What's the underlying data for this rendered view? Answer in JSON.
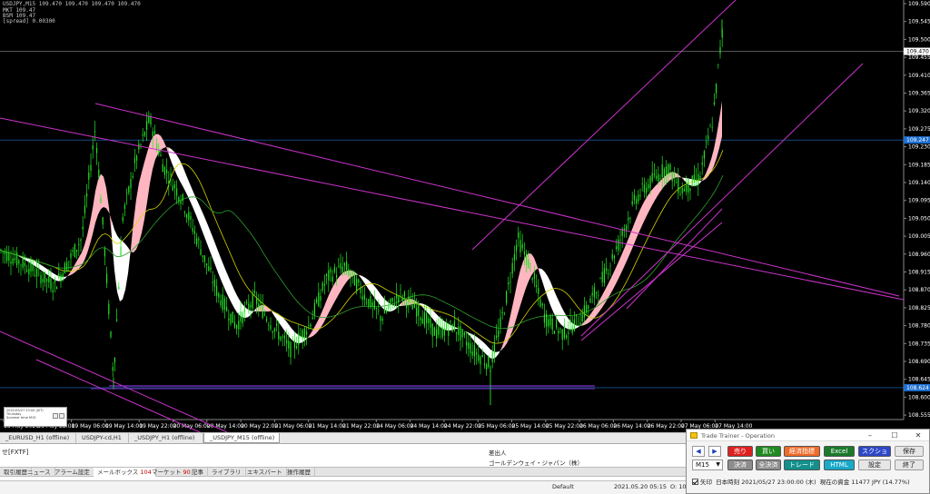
{
  "chart": {
    "symbol_line": "USDJPY,M15 109.470 109.470 109.470 109.470",
    "info_lines": [
      "MKT 109.47",
      "BSM 109.47",
      "[spread] 0.00300"
    ],
    "bg_color": "#000000",
    "candle_color": "#22e622",
    "band_up_color": "#ffb6c1",
    "band_down_color": "#ffffff",
    "trendline_color": "#cc33cc",
    "price_axis": [
      "109.590",
      "109.545",
      "109.500",
      "109.455",
      "109.410",
      "109.365",
      "109.320",
      "109.275",
      "109.230",
      "109.185",
      "109.140",
      "109.095",
      "109.050",
      "109.005",
      "108.960",
      "108.915",
      "108.870",
      "108.825",
      "108.780",
      "108.735",
      "108.690",
      "108.645",
      "108.600",
      "108.555"
    ],
    "current_price_label": "109.470",
    "level_label_1": "109.247",
    "level_label_2": "108.624",
    "time_axis": [
      "18 May 2021",
      "18 May 22:00",
      "19 May 06:00",
      "19 May 14:00",
      "19 May 22:00",
      "20 May 06:00",
      "20 May 14:00",
      "20 May 22:00",
      "21 May 06:00",
      "21 May 14:00",
      "21 May 22:00",
      "24 May 06:00",
      "24 May 14:00",
      "24 May 22:00",
      "25 May 06:00",
      "25 May 14:00",
      "25 May 22:00",
      "26 May 06:00",
      "26 May 14:00",
      "26 May 22:00",
      "27 May 06:00",
      "27 May 14:00"
    ]
  },
  "mini_window": {
    "lines": [
      "2021/05/27 23:00 (JST)",
      "Thursday",
      "Summer time    M15"
    ]
  },
  "chart_tabs": [
    "_EURUSD_H1 (offline)",
    "USDJPY-cd,H1",
    "_USDJPY_H1 (offline)",
    "_USDJPY_M15 (offline)"
  ],
  "toolbox": {
    "title": "せ[FXTF]",
    "sender_header": "差出人",
    "sender_value": "ゴールデンウェイ・ジャパン（株）",
    "tabs": [
      {
        "label": "取引履歴",
        "badge": ""
      },
      {
        "label": "ニュース",
        "badge": ""
      },
      {
        "label": "アラーム設定",
        "badge": ""
      },
      {
        "label": "メールボックス",
        "badge": "104"
      },
      {
        "label": "マーケット",
        "badge": "90"
      },
      {
        "label": "記事",
        "badge": ""
      },
      {
        "label": "ライブラリ",
        "badge": ""
      },
      {
        "label": "エキスパート",
        "badge": ""
      },
      {
        "label": "操作履歴",
        "badge": ""
      }
    ]
  },
  "status": {
    "profile": "Default",
    "datetime": "2021.05.20 05:15",
    "open": "O: 10"
  },
  "trade_trainer": {
    "title": "Trade Trainer - Operation",
    "buttons_row1": [
      "売り",
      "買い",
      "経済指標",
      "Excel",
      "スクショ",
      "保存"
    ],
    "buttons_row2": [
      "決済",
      "全決済",
      "トレード",
      "HTML",
      "設定",
      "終了"
    ],
    "nav_prev": "◀",
    "nav_next": "▶",
    "timeframe": "M15",
    "arrow_label": "矢印",
    "time_label": "日本時刻",
    "time_value": "2021/05/27 23:00:00 (木)",
    "funds_label": "現在の資金",
    "funds_value": "11477 JPY (14.77%)"
  }
}
